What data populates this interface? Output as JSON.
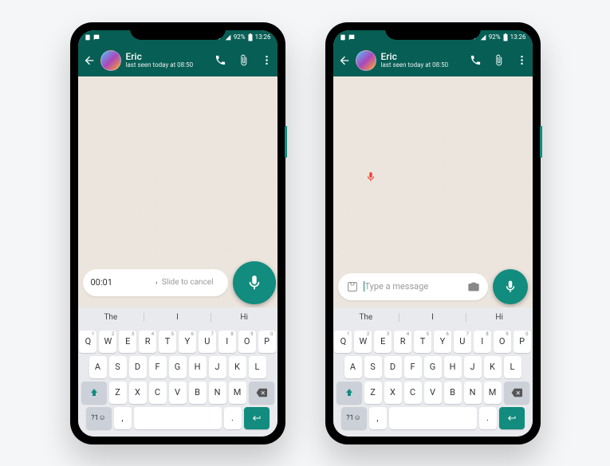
{
  "status": {
    "battery": "92%",
    "time": "13:26"
  },
  "header": {
    "name": "Eric",
    "lastseen": "last seen today at 08:50"
  },
  "phoneA": {
    "timer": "00:01",
    "slide": "Slide to cancel"
  },
  "phoneB": {
    "placeholder": "Type a message"
  },
  "suggest": [
    "The",
    "I",
    "Hi"
  ],
  "rows": {
    "r1": [
      "Q",
      "W",
      "E",
      "R",
      "T",
      "Y",
      "U",
      "I",
      "O",
      "P"
    ],
    "r1n": [
      "1",
      "2",
      "3",
      "4",
      "5",
      "6",
      "7",
      "8",
      "9",
      "0"
    ],
    "r2": [
      "A",
      "S",
      "D",
      "F",
      "G",
      "H",
      "J",
      "K",
      "L"
    ],
    "r3": [
      "Z",
      "X",
      "C",
      "V",
      "B",
      "N",
      "M"
    ]
  },
  "bottom": {
    "sym": "?1☺",
    "comma": ",",
    "dot": "."
  }
}
